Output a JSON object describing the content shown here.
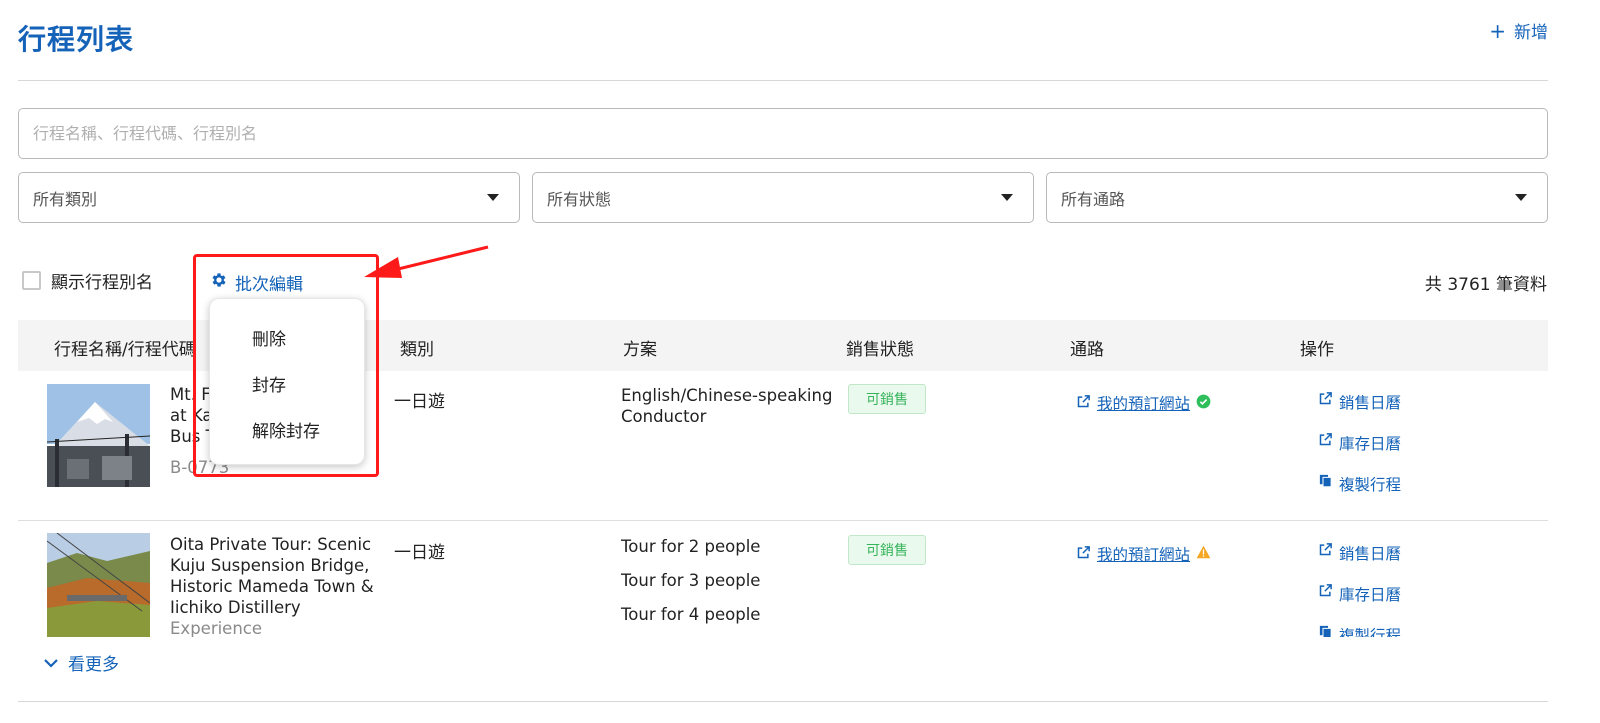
{
  "header": {
    "title": "行程列表",
    "add_label": "新增"
  },
  "search": {
    "placeholder": "行程名稱、行程代碼、行程別名",
    "value": ""
  },
  "filters": [
    {
      "label": "所有類別"
    },
    {
      "label": "所有狀態"
    },
    {
      "label": "所有通路"
    }
  ],
  "toolbar": {
    "show_alias_label": "顯示行程別名",
    "show_alias_checked": false,
    "batch_edit_label": "批次編輯",
    "total_label": "共 3761 筆資料"
  },
  "batch_menu": {
    "items": [
      {
        "label": "刪除"
      },
      {
        "label": "封存"
      },
      {
        "label": "解除封存"
      }
    ]
  },
  "table": {
    "columns": [
      "行程名稱/行程代碼",
      "類別",
      "方案",
      "銷售狀態",
      "通路",
      "操作"
    ],
    "rows": [
      {
        "name": "Mt. Fuji at Kawaguchiko Bus Tour",
        "name_visible_lines": [
          "Mt. F",
          "at Ka",
          "Bus T"
        ],
        "code": "B-0773",
        "category": "一日遊",
        "plans": [
          "English/Chinese-speaking Conductor"
        ],
        "status": "可銷售",
        "channel": {
          "label": "我的預訂網站",
          "state_icon": "check-circle",
          "state_color": "#2fbf5a"
        },
        "actions": [
          {
            "label": "銷售日曆",
            "icon": "external-link"
          },
          {
            "label": "庫存日曆",
            "icon": "external-link"
          },
          {
            "label": "複製行程",
            "icon": "copy"
          }
        ]
      },
      {
        "name_lines": [
          "Oita Private Tour: Scenic",
          "Kuju Suspension Bridge,",
          "Historic Mameda Town &",
          "Iichiko Distillery"
        ],
        "name_cut_line": "Experience",
        "category": "一日遊",
        "plans": [
          "Tour for 2 people",
          "Tour for 3 people",
          "Tour for 4 people"
        ],
        "status": "可銷售",
        "channel": {
          "label": "我的預訂網站",
          "state_icon": "warning-triangle",
          "state_color": "#f5a623"
        },
        "actions": [
          {
            "label": "銷售日曆",
            "icon": "external-link"
          },
          {
            "label": "庫存日曆",
            "icon": "external-link"
          },
          {
            "label": "複製行程",
            "icon": "copy"
          }
        ]
      }
    ]
  },
  "footer": {
    "more_label": "看更多"
  },
  "colors": {
    "primary": "#1563b8",
    "status_green": "#36b35a",
    "highlight_red": "#ff1a1a"
  }
}
